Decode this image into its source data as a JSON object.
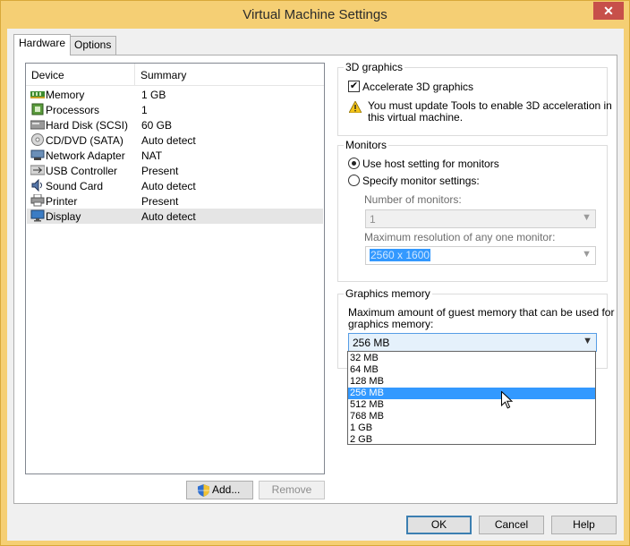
{
  "window": {
    "title": "Virtual Machine Settings",
    "close": "✕"
  },
  "tabs": [
    {
      "label": "Hardware"
    },
    {
      "label": "Options"
    }
  ],
  "device_list": {
    "headers": {
      "device": "Device",
      "summary": "Summary"
    },
    "rows": [
      {
        "name": "Memory",
        "summary": "1 GB",
        "icon": "memory-icon"
      },
      {
        "name": "Processors",
        "summary": "1",
        "icon": "processor-icon"
      },
      {
        "name": "Hard Disk (SCSI)",
        "summary": "60 GB",
        "icon": "hard-disk-icon"
      },
      {
        "name": "CD/DVD (SATA)",
        "summary": "Auto detect",
        "icon": "cd-dvd-icon"
      },
      {
        "name": "Network Adapter",
        "summary": "NAT",
        "icon": "network-adapter-icon"
      },
      {
        "name": "USB Controller",
        "summary": "Present",
        "icon": "usb-icon"
      },
      {
        "name": "Sound Card",
        "summary": "Auto detect",
        "icon": "sound-card-icon"
      },
      {
        "name": "Printer",
        "summary": "Present",
        "icon": "printer-icon"
      },
      {
        "name": "Display",
        "summary": "Auto detect",
        "icon": "display-icon"
      }
    ],
    "selected": "Display"
  },
  "buttons": {
    "add": "Add...",
    "remove": "Remove",
    "ok": "OK",
    "cancel": "Cancel",
    "help": "Help"
  },
  "graphics3d": {
    "title": "3D graphics",
    "accelerate_label": "Accelerate 3D graphics",
    "accelerate_checked": true,
    "warning_line1": "You must update Tools to enable 3D acceleration in",
    "warning_line2": "this virtual machine."
  },
  "monitors": {
    "title": "Monitors",
    "use_host_label": "Use host setting for monitors",
    "specify_label": "Specify monitor settings:",
    "selected": "use_host",
    "num_monitors_label": "Number of monitors:",
    "num_monitors_value": "1",
    "max_res_label": "Maximum resolution of any one monitor:",
    "max_res_value": "2560 x 1600"
  },
  "graphics_memory": {
    "title": "Graphics memory",
    "desc_line1": "Maximum amount of guest memory that can be used for",
    "desc_line2": "graphics memory:",
    "value": "256 MB",
    "options": [
      "32 MB",
      "64 MB",
      "128 MB",
      "256 MB",
      "512 MB",
      "768 MB",
      "1 GB",
      "2 GB"
    ],
    "highlighted": "256 MB"
  },
  "colors": {
    "accent": "#3399ff",
    "titlebar": "#f5cf74",
    "close": "#c7504a"
  }
}
